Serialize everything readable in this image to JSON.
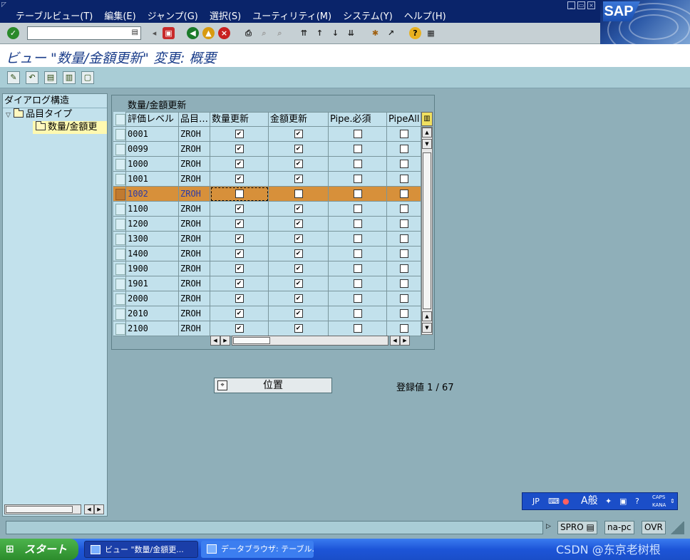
{
  "menu": [
    "テーブルビュー(T)",
    "編集(E)",
    "ジャンプ(G)",
    "選択(S)",
    "ユーティリティ(M)",
    "システム(Y)",
    "ヘルプ(H)"
  ],
  "window": {
    "minimize": "_",
    "restore": "▭",
    "close": "×"
  },
  "logo": "SAP",
  "command_field": {
    "value": "",
    "placeholder": ""
  },
  "title": "ビュー \"数量/金額更新\" 変更: 概要",
  "tree": {
    "header": "ダイアログ構造",
    "items": [
      {
        "label": "品目タイプ"
      },
      {
        "label": "数量/金額更"
      }
    ]
  },
  "table": {
    "group_title": "数量/金額更新",
    "columns": [
      "評価レベル",
      "品目…",
      "数量更新",
      "金額更新",
      "Pipe.必須",
      "PipeAll"
    ],
    "rows": [
      {
        "level": "0001",
        "type": "ZROH",
        "qty": true,
        "val": true,
        "pipe": false,
        "pipeall": false
      },
      {
        "level": "0099",
        "type": "ZROH",
        "qty": true,
        "val": true,
        "pipe": false,
        "pipeall": false
      },
      {
        "level": "1000",
        "type": "ZROH",
        "qty": true,
        "val": true,
        "pipe": false,
        "pipeall": false
      },
      {
        "level": "1001",
        "type": "ZROH",
        "qty": true,
        "val": true,
        "pipe": false,
        "pipeall": false
      },
      {
        "level": "1002",
        "type": "ZROH",
        "qty": false,
        "val": false,
        "pipe": false,
        "pipeall": false
      },
      {
        "level": "1100",
        "type": "ZROH",
        "qty": true,
        "val": true,
        "pipe": false,
        "pipeall": false
      },
      {
        "level": "1200",
        "type": "ZROH",
        "qty": true,
        "val": true,
        "pipe": false,
        "pipeall": false
      },
      {
        "level": "1300",
        "type": "ZROH",
        "qty": true,
        "val": true,
        "pipe": false,
        "pipeall": false
      },
      {
        "level": "1400",
        "type": "ZROH",
        "qty": true,
        "val": true,
        "pipe": false,
        "pipeall": false
      },
      {
        "level": "1900",
        "type": "ZROH",
        "qty": true,
        "val": true,
        "pipe": false,
        "pipeall": false
      },
      {
        "level": "1901",
        "type": "ZROH",
        "qty": true,
        "val": true,
        "pipe": false,
        "pipeall": false
      },
      {
        "level": "2000",
        "type": "ZROH",
        "qty": true,
        "val": true,
        "pipe": false,
        "pipeall": false
      },
      {
        "level": "2010",
        "type": "ZROH",
        "qty": true,
        "val": true,
        "pipe": false,
        "pipeall": false
      },
      {
        "level": "2100",
        "type": "ZROH",
        "qty": true,
        "val": true,
        "pipe": false,
        "pipeall": false
      }
    ],
    "highlight_color": "#d7903a"
  },
  "position_button": "位置",
  "entry_count": "登録値 1 / 67",
  "ime": {
    "lang": "JP",
    "mode": "A般",
    "caps": "CAPS",
    "kana": "KANA"
  },
  "status": {
    "transaction": "SPRO",
    "server": "na-pc",
    "mode": "OVR"
  },
  "taskbar": {
    "start": "スタート",
    "tasks": [
      "ビュー \"数量/金額更...",
      "データブラウザ: テーブル..."
    ]
  },
  "watermark": "CSDN @东京老树根"
}
